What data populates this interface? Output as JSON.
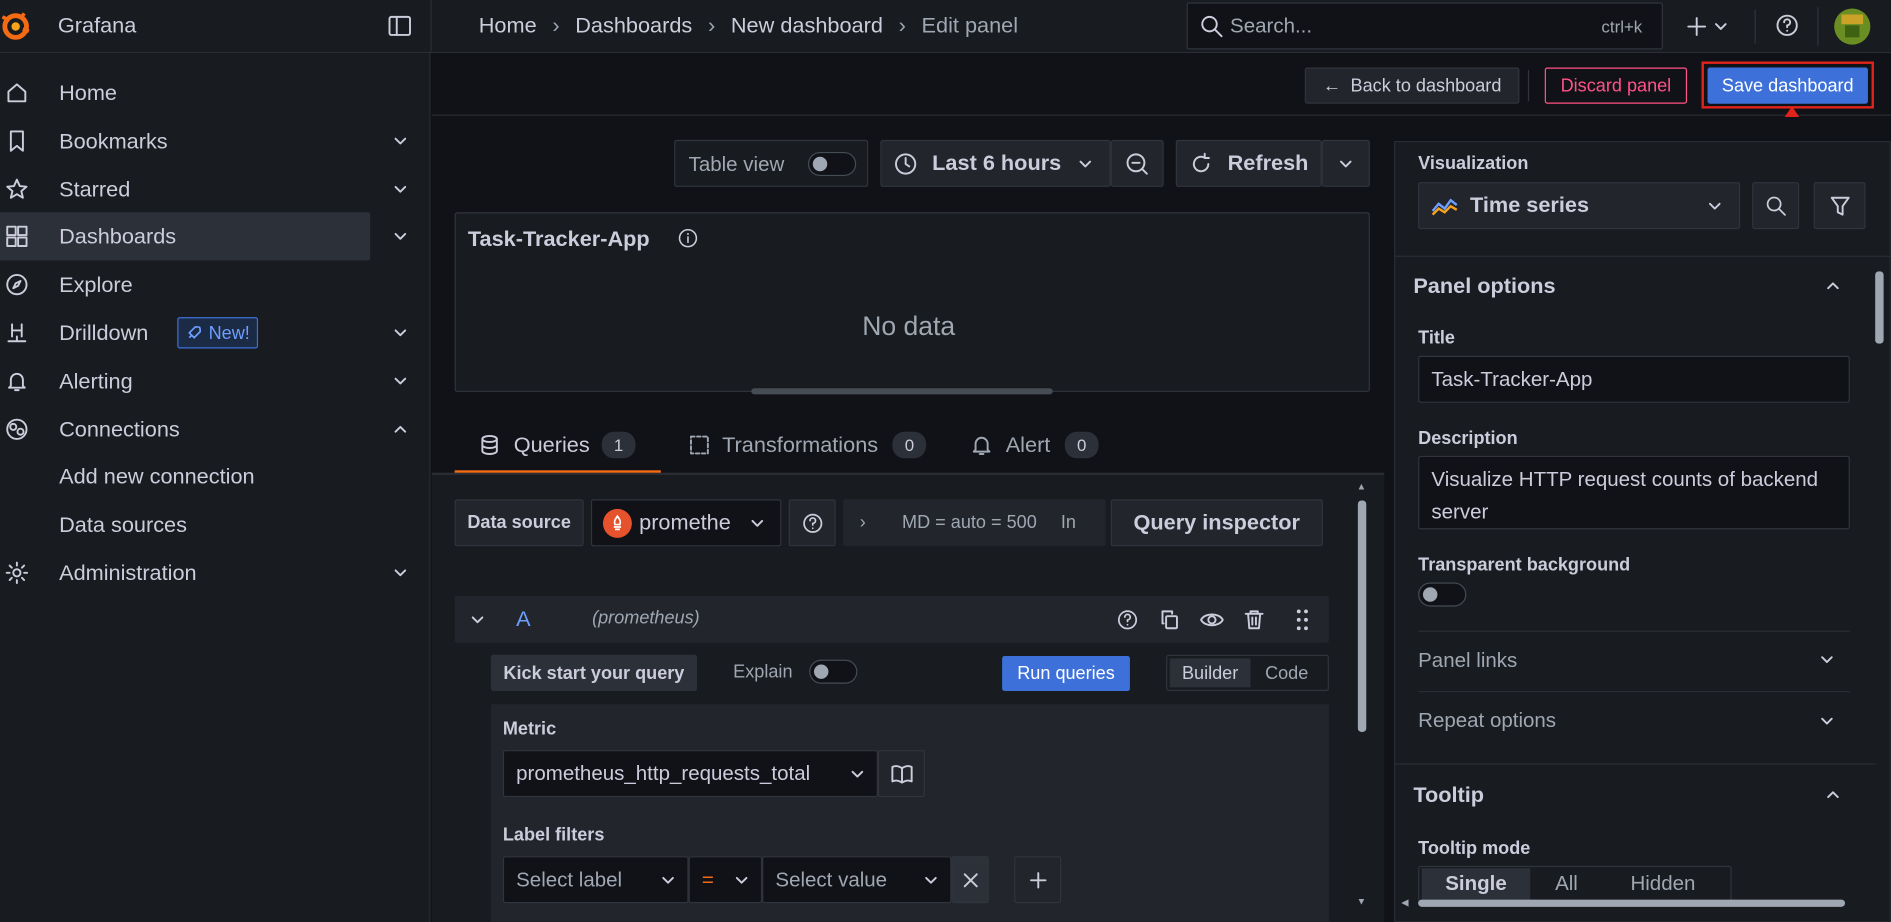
{
  "app": {
    "name": "Grafana"
  },
  "breadcrumb": [
    "Home",
    "Dashboards",
    "New dashboard",
    "Edit panel"
  ],
  "search": {
    "placeholder": "Search...",
    "shortcut": "ctrl+k"
  },
  "sidebar": {
    "items": [
      {
        "label": "Home",
        "icon": "home-icon"
      },
      {
        "label": "Bookmarks",
        "icon": "bookmark-icon"
      },
      {
        "label": "Starred",
        "icon": "star-icon"
      },
      {
        "label": "Dashboards",
        "icon": "dashboards-icon"
      },
      {
        "label": "Explore",
        "icon": "compass-icon"
      },
      {
        "label": "Drilldown",
        "icon": "drilldown-icon",
        "badge": "New!"
      },
      {
        "label": "Alerting",
        "icon": "bell-icon"
      },
      {
        "label": "Connections",
        "icon": "connections-icon"
      },
      {
        "label": "Add new connection"
      },
      {
        "label": "Data sources"
      },
      {
        "label": "Administration",
        "icon": "gear-icon"
      }
    ]
  },
  "toolbar": {
    "back": "Back to dashboard",
    "discard": "Discard panel",
    "save": "Save dashboard"
  },
  "preview": {
    "table_view": "Table view",
    "time_range": "Last 6 hours",
    "refresh": "Refresh",
    "panel_title": "Task-Tracker-App",
    "no_data": "No data"
  },
  "tabs": [
    {
      "label": "Queries",
      "count": "1"
    },
    {
      "label": "Transformations",
      "count": "0"
    },
    {
      "label": "Alert",
      "count": "0"
    }
  ],
  "query": {
    "datasource_label": "Data source",
    "datasource_value": "promethe",
    "options": "MD = auto = 500",
    "options_tail": "In",
    "inspector": "Query inspector",
    "ref": "A",
    "ref_ds": "(prometheus)",
    "kick_start": "Kick start your query",
    "explain": "Explain",
    "run": "Run queries",
    "builder": "Builder",
    "code": "Code",
    "metric_label": "Metric",
    "metric_value": "prometheus_http_requests_total",
    "label_filters": "Label filters",
    "select_label": "Select label",
    "operator": "=",
    "select_value": "Select value"
  },
  "options_pane": {
    "visualization_label": "Visualization",
    "visualization_value": "Time series",
    "panel_options": "Panel options",
    "title_label": "Title",
    "title_value": "Task-Tracker-App",
    "description_label": "Description",
    "description_value": "Visualize HTTP request counts of backend server",
    "transparent_label": "Transparent background",
    "panel_links": "Panel links",
    "repeat_options": "Repeat options",
    "tooltip": "Tooltip",
    "tooltip_mode": "Tooltip mode",
    "tooltip_options": [
      "Single",
      "All",
      "Hidden"
    ]
  },
  "colors": {
    "accent": "#3d71d9",
    "annotation": "#e0231b",
    "discard": "#ff5286",
    "active_tab": "#f46b14"
  }
}
